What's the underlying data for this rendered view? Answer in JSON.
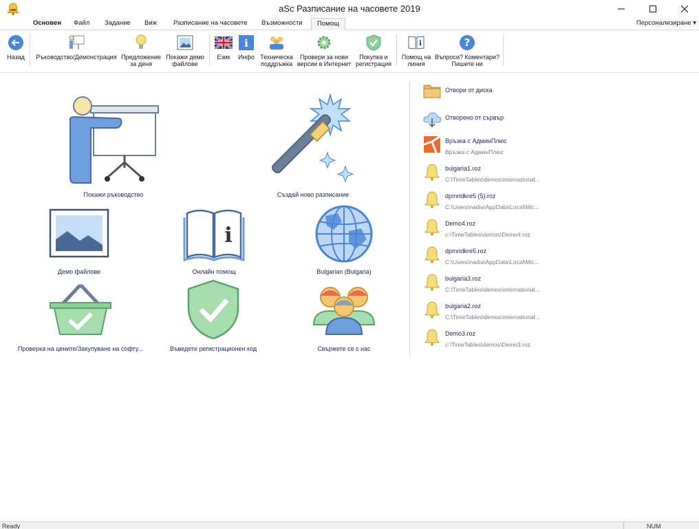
{
  "window": {
    "title": "aSc Разписание на часовете 2019"
  },
  "tabs": [
    {
      "label": "Основен"
    },
    {
      "label": "Файл"
    },
    {
      "label": "Задание"
    },
    {
      "label": "Виж"
    },
    {
      "label": "Разписание на часовете"
    },
    {
      "label": "Възможности"
    },
    {
      "label": "Помощ"
    }
  ],
  "customize_label": "Персонализиране ▾",
  "ribbon": [
    {
      "label": "Назад",
      "icon": "back-arrow-icon"
    },
    {
      "label": "Ръководство/Демонстрация",
      "icon": "presentation-icon"
    },
    {
      "label": "Предложение\nза деня",
      "icon": "lightbulb-icon"
    },
    {
      "label": "Покажи демо\nфайлове",
      "icon": "picture-icon"
    },
    {
      "label": "Език",
      "icon": "uk-flag-icon"
    },
    {
      "label": "Инфо",
      "icon": "info-icon"
    },
    {
      "label": "Техническа\nподдръжка",
      "icon": "support-people-icon"
    },
    {
      "label": "Провери за нови\nверсии в Интернет",
      "icon": "gear-update-icon"
    },
    {
      "label": "Покупка и\nрегистрация",
      "icon": "shield-check-icon"
    },
    {
      "label": "Помощ на\nлиния",
      "icon": "book-info-icon"
    },
    {
      "label": "Въпроси? Коментари?\nПишете ни",
      "icon": "question-icon"
    }
  ],
  "tiles": {
    "guide": "Покажи ръководство",
    "new_timetable": "Създай ново разписание",
    "demo_files": "Демо файлове",
    "online_help": "Онлайн помощ",
    "language": "Bulgarian (Bulgaria)",
    "pricing": "Проверка на цените/Закупуване на софту...",
    "registration": "Въведете регистрационен код",
    "contact": "Свържете се с нас"
  },
  "recent": [
    {
      "title": "Отвори от диска",
      "subtitle": "",
      "icon": "folder-icon"
    },
    {
      "title": "Отворено от сървър",
      "subtitle": "",
      "icon": "cloud-icon"
    },
    {
      "title": "Връзка с АдминПлюс",
      "subtitle": "Връзка с АдминПлюс",
      "icon": "adminplus-logo-icon"
    },
    {
      "title": "bulgaria1.roz",
      "subtitle": "C:\\TimeTables\\demos\\international...",
      "icon": "bell-icon"
    },
    {
      "title": "dpmridkre5 (5).roz",
      "subtitle": "C:\\Users\\nadia\\AppData\\Local\\Mic...",
      "icon": "bell-icon"
    },
    {
      "title": "Demo4.roz",
      "subtitle": "c:\\TimeTables\\demos\\Demo4.roz",
      "icon": "bell-icon"
    },
    {
      "title": "dpmridkre5.roz",
      "subtitle": "C:\\Users\\nadia\\AppData\\Local\\Mic...",
      "icon": "bell-icon"
    },
    {
      "title": "bulgaria3.roz",
      "subtitle": "C:\\TimeTables\\demos\\international...",
      "icon": "bell-icon"
    },
    {
      "title": "bulgaria2.roz",
      "subtitle": "C:\\TimeTables\\demos\\international...",
      "icon": "bell-icon"
    },
    {
      "title": "Demo3.roz",
      "subtitle": "c:\\TimeTables\\demos\\Demo3.roz",
      "icon": "bell-icon"
    }
  ],
  "status": {
    "left": "Ready",
    "right": "NUM"
  },
  "colors": {
    "accent_blue": "#4a7fd4",
    "icon_green": "#8fcf9a",
    "bell_yellow": "#f5d76e"
  }
}
